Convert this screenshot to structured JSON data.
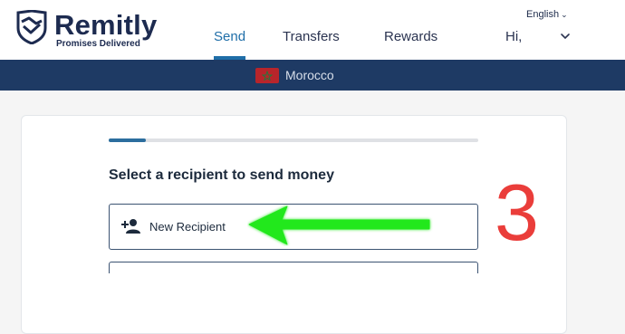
{
  "header": {
    "brand_name": "Remitly",
    "brand_tagline": "Promises Delivered",
    "nav": [
      {
        "label": "Send",
        "active": true
      },
      {
        "label": "Transfers",
        "active": false
      },
      {
        "label": "Rewards",
        "active": false
      }
    ],
    "language": "English",
    "greeting": "Hi,"
  },
  "country_bar": {
    "country": "Morocco",
    "flag_color": "#b8252b"
  },
  "main": {
    "progress_fraction": 0.1,
    "title": "Select a recipient to send money",
    "new_recipient_label": "New Recipient"
  },
  "annotation": {
    "step_number": "3",
    "arrow_color": "#22e81f",
    "step_color": "#ea3d3a"
  },
  "colors": {
    "accent": "#1f6ea8",
    "header_bar": "#1e3a64"
  }
}
